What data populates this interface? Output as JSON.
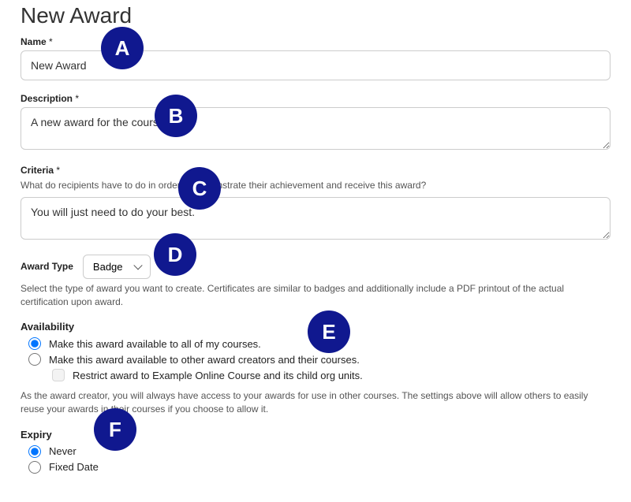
{
  "page": {
    "title": "New Award"
  },
  "name": {
    "label": "Name",
    "value": "New Award"
  },
  "description": {
    "label": "Description",
    "value": "A new award for the course"
  },
  "criteria": {
    "label": "Criteria",
    "help": "What do recipients have to do in order to demonstrate their achievement and receive this award?",
    "value": "You will just need to do your best."
  },
  "award_type": {
    "label": "Award Type",
    "selected": "Badge",
    "help": "Select the type of award you want to create. Certificates are similar to badges and additionally include a PDF printout of the actual certification upon award."
  },
  "availability": {
    "heading": "Availability",
    "opt_all": "Make this award available to all of my courses.",
    "opt_others": "Make this award available to other award creators and their courses.",
    "restrict": "Restrict award to Example Online Course and its child org units.",
    "note": "As the award creator, you will always have access to your awards for use in other courses. The settings above will allow others to easily reuse your awards in their courses if you choose to allow it."
  },
  "expiry": {
    "heading": "Expiry",
    "opt_never": "Never",
    "opt_fixed": "Fixed Date"
  },
  "annotations": {
    "a": "A",
    "b": "B",
    "c": "C",
    "d": "D",
    "e": "E",
    "f": "F"
  }
}
